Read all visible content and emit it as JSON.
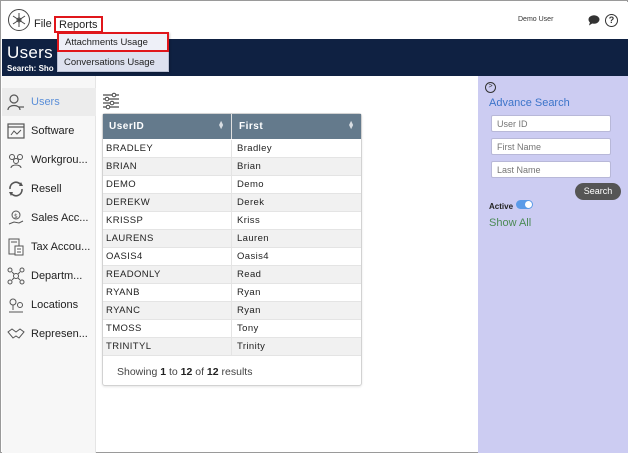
{
  "topbar": {
    "menu": {
      "file": "File",
      "reports": "Reports"
    },
    "user_name": "Demo User",
    "icons": [
      "logo-icon",
      "chat-icon",
      "help-icon"
    ]
  },
  "header": {
    "title": "Users L",
    "search_caption": "Search: Sho"
  },
  "reports_menu": {
    "items": [
      "Attachments Usage",
      "Conversations Usage"
    ],
    "highlighted": "Attachments Usage"
  },
  "sidebar": {
    "items": [
      {
        "label": "Users",
        "icon": "user-icon",
        "active": true
      },
      {
        "label": "Software",
        "icon": "software-icon"
      },
      {
        "label": "Workgrou...",
        "icon": "workgroup-icon"
      },
      {
        "label": "Resell",
        "icon": "resell-icon"
      },
      {
        "label": "Sales Acc...",
        "icon": "sales-account-icon"
      },
      {
        "label": "Tax Accou...",
        "icon": "tax-account-icon"
      },
      {
        "label": "Departm...",
        "icon": "department-icon"
      },
      {
        "label": "Locations",
        "icon": "location-icon"
      },
      {
        "label": "Represen...",
        "icon": "representative-icon"
      }
    ]
  },
  "table": {
    "columns": [
      "UserID",
      "First"
    ],
    "rows": [
      [
        "BRADLEY",
        "Bradley"
      ],
      [
        "BRIAN",
        "Brian"
      ],
      [
        "DEMO",
        "Demo"
      ],
      [
        "DEREKW",
        "Derek"
      ],
      [
        "KRISSP",
        "Kriss"
      ],
      [
        "LAURENS",
        "Lauren"
      ],
      [
        "OASIS4",
        "Oasis4"
      ],
      [
        "READONLY",
        "Read"
      ],
      [
        "RYANB",
        "Ryan"
      ],
      [
        "RYANC",
        "Ryan"
      ],
      [
        "TMOSS",
        "Tony"
      ],
      [
        "TRINITYL",
        "Trinity"
      ]
    ],
    "footer": {
      "prefix": "Showing ",
      "from": "1",
      "to_word": " to ",
      "to": "12",
      "of_word": " of ",
      "total": "12",
      "suffix": " results"
    }
  },
  "advance_search": {
    "title": "Advance Search",
    "placeholders": {
      "user_id": "User ID",
      "first_name": "First Name",
      "last_name": "Last Name"
    },
    "search_button": "Search",
    "active_label": "Active",
    "active_on": true,
    "show_all": "Show All"
  },
  "colors": {
    "header_band": "#0f2142",
    "table_header": "#647a8c",
    "right_panel": "#ccccf2",
    "highlight_box": "#e0161b",
    "link_blue": "#3c74c9",
    "link_green": "#4c8a55"
  }
}
